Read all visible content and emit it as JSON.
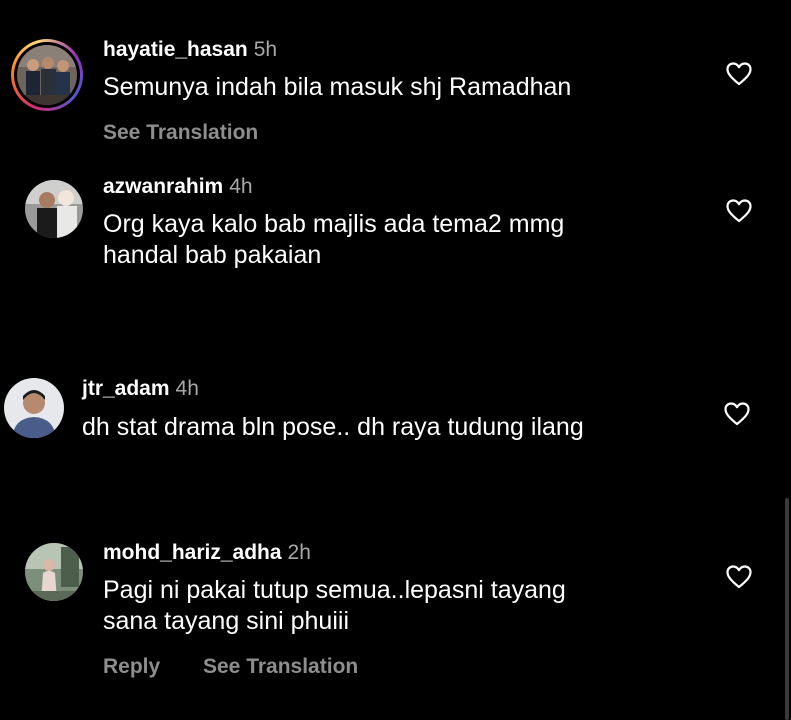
{
  "comments": [
    {
      "username": "hayatie_hasan",
      "time": "5h",
      "lines": [
        "Semunya indah bila masuk shj Ramadhan"
      ],
      "actions": [
        "See Translation"
      ],
      "has_story_ring": true
    },
    {
      "username": "azwanrahim",
      "time": "4h",
      "lines": [
        "Org kaya kalo bab majlis ada tema2 mmg",
        "handal bab pakaian"
      ],
      "actions": [],
      "has_story_ring": false
    },
    {
      "username": "jtr_adam",
      "time": "4h",
      "lines": [
        "dh stat drama bln pose.. dh raya tudung ilang"
      ],
      "actions": [],
      "has_story_ring": false
    },
    {
      "username": "mohd_hariz_adha",
      "time": "2h",
      "lines": [
        "Pagi ni pakai tutup semua..lepasni tayang",
        "sana tayang sini phuiii"
      ],
      "actions": [
        "Reply",
        "See Translation"
      ],
      "has_story_ring": false
    }
  ],
  "icons": {
    "like": "heart-outline-icon"
  },
  "colors": {
    "background": "#000000",
    "text": "#ffffff",
    "secondary": "#a8a8a8",
    "action": "#8e8e8e"
  }
}
